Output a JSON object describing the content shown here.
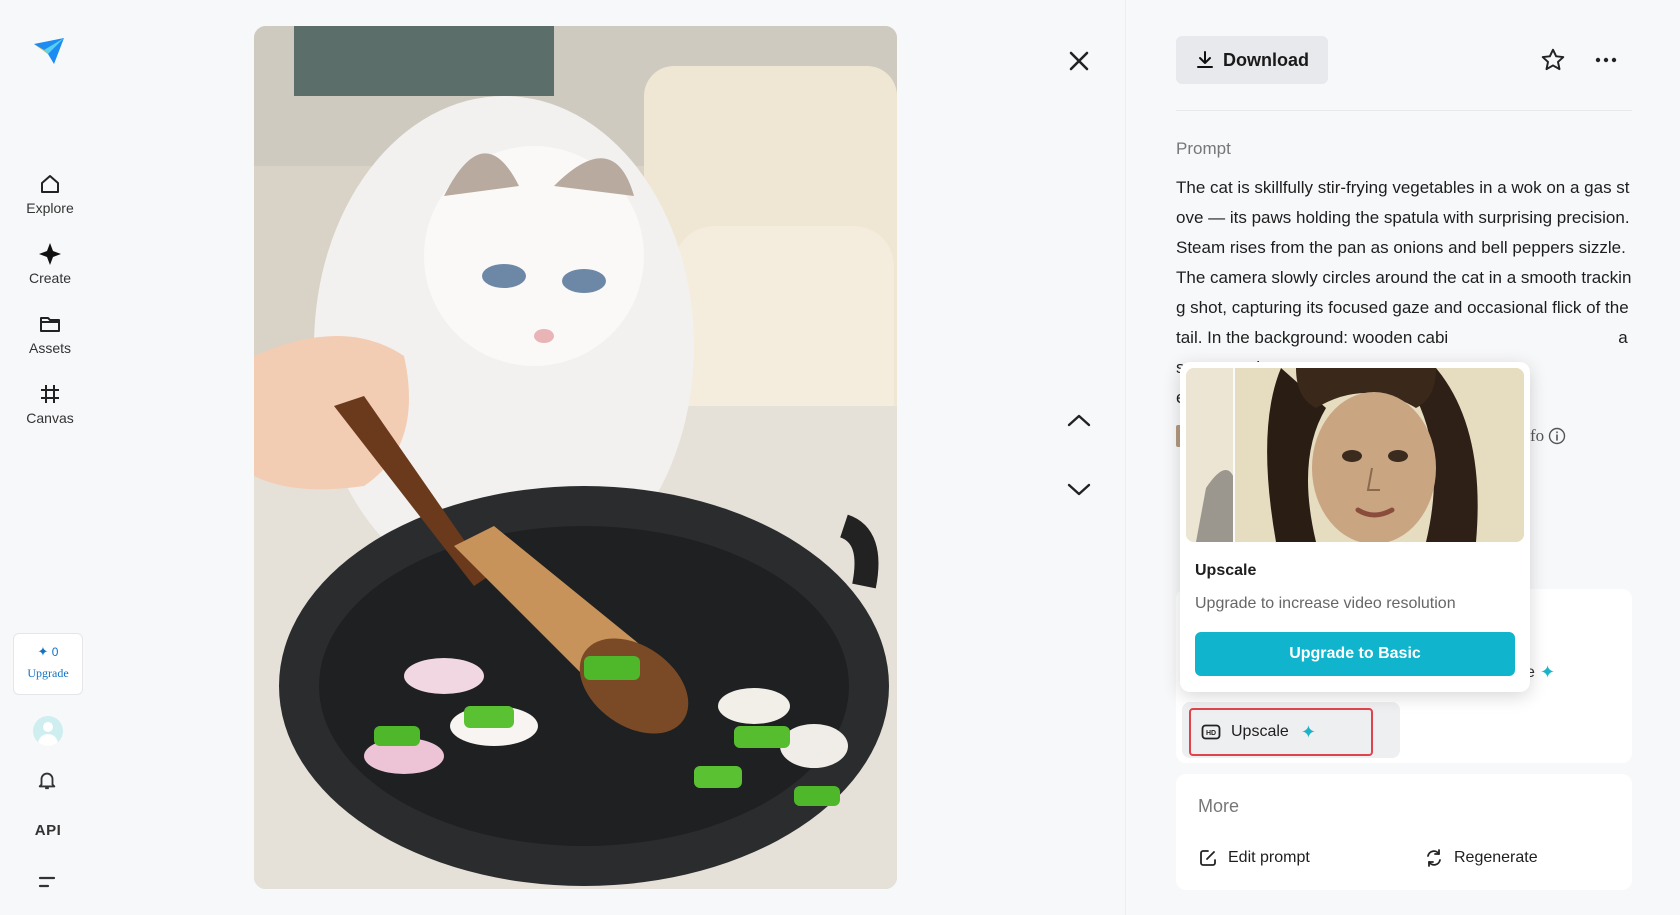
{
  "sidebar": {
    "logo": "paper-plane-logo",
    "items": [
      {
        "label": "Explore",
        "icon": "home-icon"
      },
      {
        "label": "Create",
        "icon": "sparkle-icon"
      },
      {
        "label": "Assets",
        "icon": "folder-icon"
      },
      {
        "label": "Canvas",
        "icon": "frame-icon"
      }
    ],
    "credits": {
      "count": "0",
      "upgrade_label": "Upgrade"
    },
    "api_label": "API"
  },
  "viewer": {
    "image_alt": "cat stir-frying vegetables"
  },
  "panel": {
    "download_label": "Download",
    "prompt_heading": "Prompt",
    "prompt_text": "The cat is skillfully stir-frying vegetables in a wok on a gas stove — its paws holding the spatula with surprising precision. Steam rises from the pan as onions and bell peppers sizzle. The camera slowly circles around the cat in a smooth tracking shot, capturing its focused gaze and occasional flick of the tail. In the background: wooden cabi",
    "prompt_line7_tail": "a sunny gard",
    "prompt_line8_start": "e",
    "info_fragment": "fo",
    "behind_label": "e",
    "upscale_label": "Upscale",
    "more_heading": "More",
    "edit_prompt_label": "Edit prompt",
    "regenerate_label": "Regenerate"
  },
  "popover": {
    "title": "Upscale",
    "description": "Upgrade to increase video resolution",
    "cta_label": "Upgrade to Basic"
  },
  "colors": {
    "accent": "#10b4cc",
    "highlight_border": "#e0444b",
    "link": "#1273c5"
  }
}
